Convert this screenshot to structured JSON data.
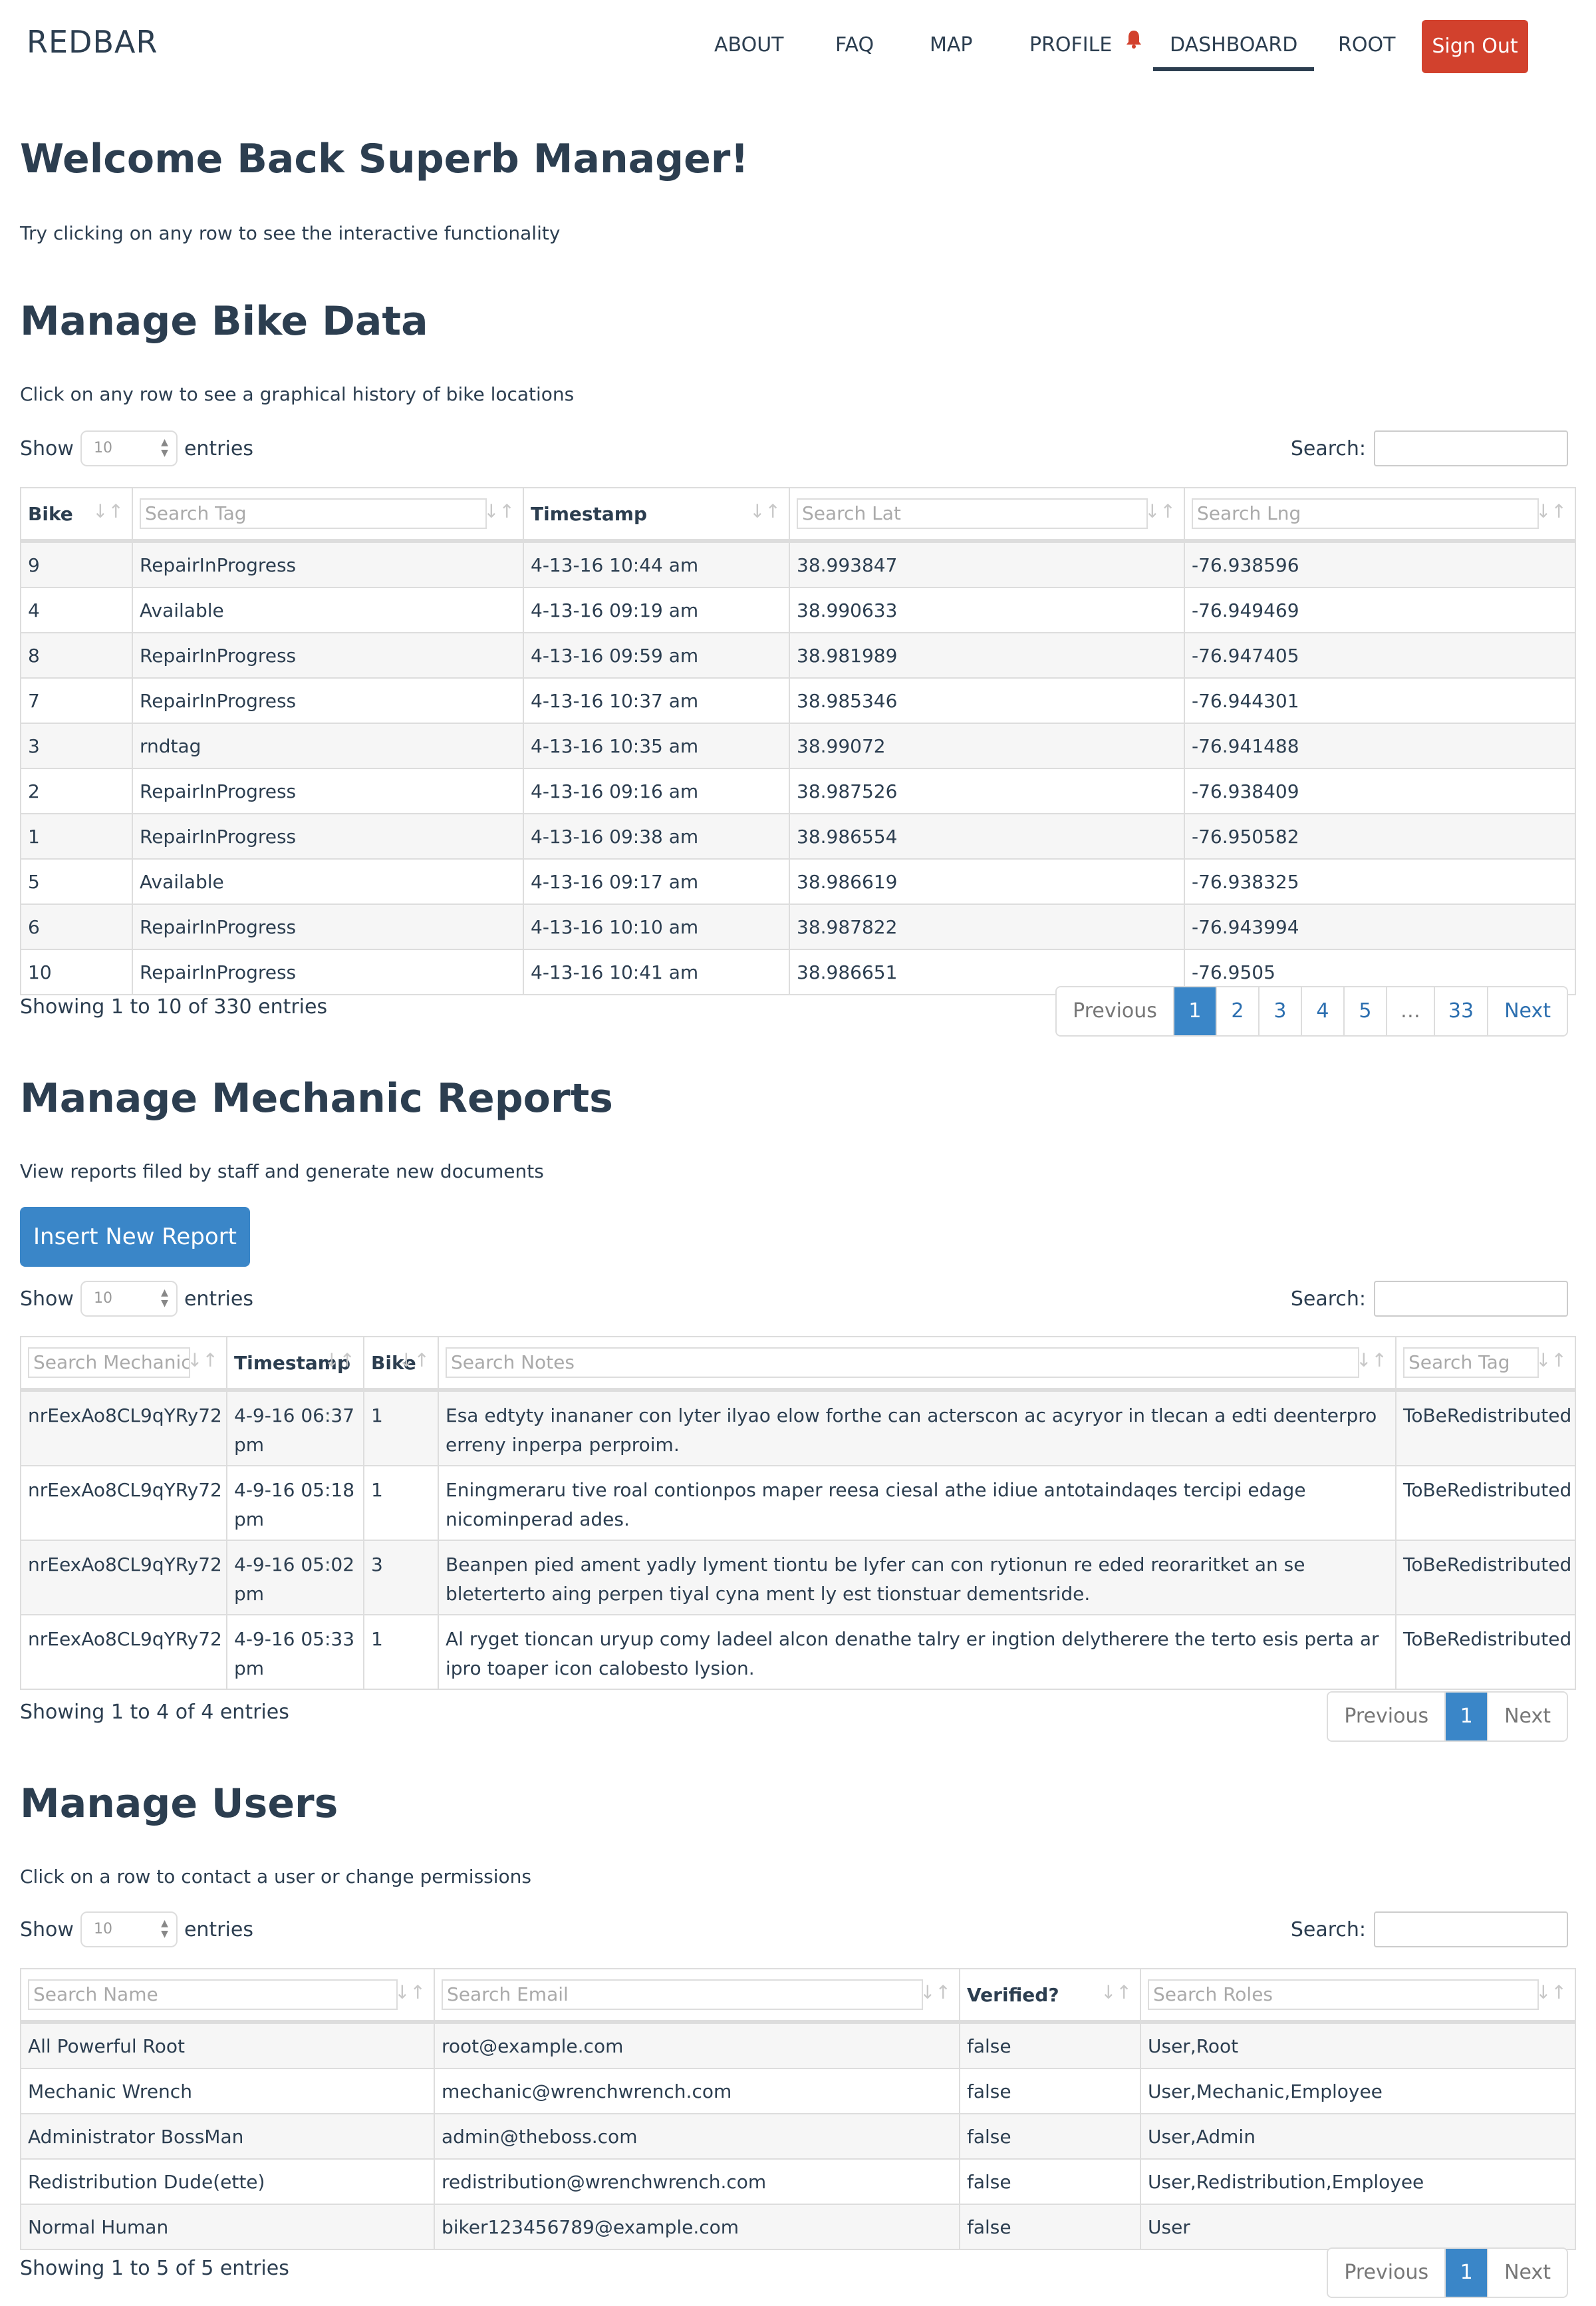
{
  "navbar": {
    "brand": "REDBAR",
    "items": [
      "ABOUT",
      "FAQ",
      "MAP",
      "PROFILE",
      "DASHBOARD",
      "ROOT"
    ],
    "active": "DASHBOARD",
    "sign_out": "Sign Out",
    "notification_color": "#d2412d"
  },
  "welcome": {
    "title": "Welcome Back Superb Manager!",
    "subtitle": "Try clicking on any row to see the interactive functionality"
  },
  "common": {
    "show": "Show",
    "entries": "entries",
    "search": "Search:",
    "length_value": "10",
    "previous": "Previous",
    "next": "Next"
  },
  "bikes": {
    "title": "Manage Bike Data",
    "description": "Click on any row to see a graphical history of bike locations",
    "headers": [
      "Bike",
      "Search Tag",
      "Timestamp",
      "Search Lat",
      "Search Lng"
    ],
    "rows": [
      [
        "9",
        "RepairInProgress",
        "4-13-16 10:44 am",
        "38.993847",
        "-76.938596"
      ],
      [
        "4",
        "Available",
        "4-13-16 09:19 am",
        "38.990633",
        "-76.949469"
      ],
      [
        "8",
        "RepairInProgress",
        "4-13-16 09:59 am",
        "38.981989",
        "-76.947405"
      ],
      [
        "7",
        "RepairInProgress",
        "4-13-16 10:37 am",
        "38.985346",
        "-76.944301"
      ],
      [
        "3",
        "rndtag",
        "4-13-16 10:35 am",
        "38.99072",
        "-76.941488"
      ],
      [
        "2",
        "RepairInProgress",
        "4-13-16 09:16 am",
        "38.987526",
        "-76.938409"
      ],
      [
        "1",
        "RepairInProgress",
        "4-13-16 09:38 am",
        "38.986554",
        "-76.950582"
      ],
      [
        "5",
        "Available",
        "4-13-16 09:17 am",
        "38.986619",
        "-76.938325"
      ],
      [
        "6",
        "RepairInProgress",
        "4-13-16 10:10 am",
        "38.987822",
        "-76.943994"
      ],
      [
        "10",
        "RepairInProgress",
        "4-13-16 10:41 am",
        "38.986651",
        "-76.9505"
      ]
    ],
    "info": "Showing 1 to 10 of 330 entries",
    "pages": [
      "1",
      "2",
      "3",
      "4",
      "5",
      "…",
      "33"
    ],
    "current_page": "1"
  },
  "reports": {
    "title": "Manage Mechanic Reports",
    "description": "View reports filed by staff and generate new documents",
    "insert_button": "Insert New Report",
    "headers": [
      "Search MechanicID",
      "Timestamp",
      "Bike",
      "Search Notes",
      "Search Tag"
    ],
    "rows": [
      [
        "nrEexAo8CL9qYRy72",
        "4-9-16 06:37 pm",
        "1",
        "Esa edtyty inananer con lyter ilyao elow forthe can acterscon ac acyryor in tlecan a edti deenterpro erreny inperpa perproim.",
        "ToBeRedistributed"
      ],
      [
        "nrEexAo8CL9qYRy72",
        "4-9-16 05:18 pm",
        "1",
        "Eningmeraru tive roal contionpos maper reesa ciesal athe idiue antotaindaqes tercipi edage nicominperad ades.",
        "ToBeRedistributed"
      ],
      [
        "nrEexAo8CL9qYRy72",
        "4-9-16 05:02 pm",
        "3",
        "Beanpen pied ament yadly lyment tiontu be lyfer can con rytionun re eded reoraritket an se bleterterto aing perpen tiyal cyna ment ly est tionstuar dementsride.",
        "ToBeRedistributed"
      ],
      [
        "nrEexAo8CL9qYRy72",
        "4-9-16 05:33 pm",
        "1",
        "Al ryget tioncan uryup comy ladeel alcon denathe talry er ingtion delytherere the terto esis perta ar ipro toaper icon calobesto lysion.",
        "ToBeRedistributed"
      ]
    ],
    "info": "Showing 1 to 4 of 4 entries",
    "pages": [
      "1"
    ],
    "current_page": "1"
  },
  "users": {
    "title": "Manage Users",
    "description": "Click on a row to contact a user or change permissions",
    "headers": [
      "Search Name",
      "Search Email",
      "Verified?",
      "Search Roles"
    ],
    "rows": [
      [
        "All Powerful Root",
        "root@example.com",
        "false",
        "User,Root"
      ],
      [
        "Mechanic Wrench",
        "mechanic@wrenchwrench.com",
        "false",
        "User,Mechanic,Employee"
      ],
      [
        "Administrator BossMan",
        "admin@theboss.com",
        "false",
        "User,Admin"
      ],
      [
        "Redistribution Dude(ette)",
        "redistribution@wrenchwrench.com",
        "false",
        "User,Redistribution,Employee"
      ],
      [
        "Normal Human",
        "biker123456789@example.com",
        "false",
        "User"
      ]
    ],
    "info": "Showing 1 to 5 of 5 entries",
    "pages": [
      "1"
    ],
    "current_page": "1"
  }
}
